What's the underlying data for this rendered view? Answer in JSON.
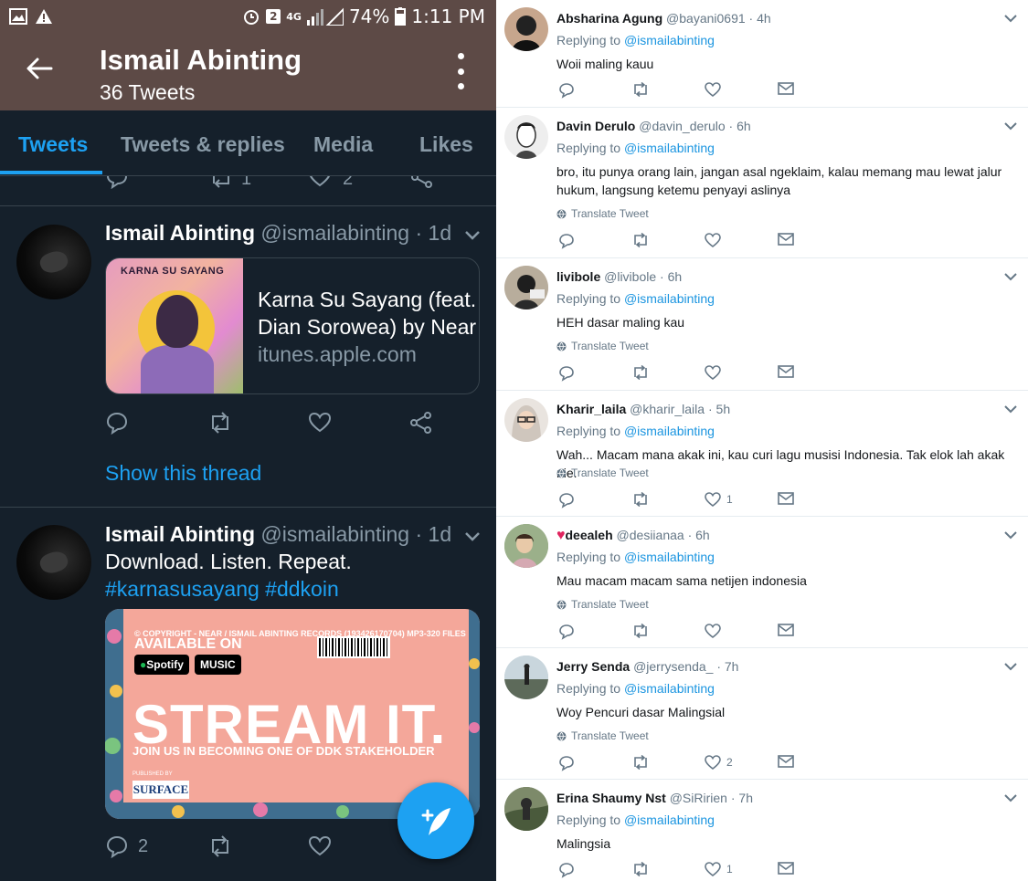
{
  "status_bar": {
    "notif_count": "2",
    "network": "4G",
    "battery": "74%",
    "time": "1:11 PM"
  },
  "profile": {
    "name": "Ismail Abinting",
    "tweet_count": "36 Tweets"
  },
  "tabs": [
    {
      "label": "Tweets",
      "active": true
    },
    {
      "label": "Tweets & replies",
      "active": false
    },
    {
      "label": "Media",
      "active": false
    },
    {
      "label": "Likes",
      "active": false
    }
  ],
  "partial_tweet_actions": {
    "retweets": "1",
    "likes": "2"
  },
  "mobile_tweets": [
    {
      "name": "Ismail Abinting",
      "handle": "@ismailabinting",
      "time": "1d",
      "card": {
        "image_title": "KARNA SU SAYANG",
        "title": "Karna Su Sayang (feat. Dian Sorowea) by Near",
        "domain": "itunes.apple.com"
      },
      "show_thread": "Show this thread"
    },
    {
      "name": "Ismail Abinting",
      "handle": "@ismailabinting",
      "time": "1d",
      "text": "Download. Listen. Repeat.",
      "hashtags": "#karnasusayang #ddkoin",
      "banner": {
        "copyright": "© COPYRIGHT - NEAR / ISMAIL ABINTING RECORDS (193426170704) MP3-320 FILES",
        "available": "AVAILABLE ON",
        "spotify": "Spotify",
        "music": "MUSIC",
        "stream": "STREAM IT.",
        "join": "JOIN US IN BECOMING ONE OF DDK STAKEHOLDER",
        "published": "PUBLISHED BY",
        "publisher": "SURFACE"
      },
      "replies": "2"
    }
  ],
  "replies": [
    {
      "name": "Absharina Agung",
      "handle": "@bayani0691",
      "time": "4h",
      "replying": "Replying to",
      "mention": "@ismailabinting",
      "text": "Woii maling kauu",
      "translate": "",
      "likes": ""
    },
    {
      "name": "Davin Derulo",
      "handle": "@davin_derulo",
      "time": "6h",
      "replying": "Replying to",
      "mention": "@ismailabinting",
      "text": "bro, itu punya orang lain, jangan asal ngeklaim, kalau memang mau lewat jalur hukum, langsung ketemu penyayi aslinya",
      "translate": "Translate Tweet",
      "likes": ""
    },
    {
      "name": "livibole",
      "handle": "@livibole",
      "time": "6h",
      "replying": "Replying to",
      "mention": "@ismailabinting",
      "text": "HEH dasar maling kau",
      "translate": "Translate Tweet",
      "likes": ""
    },
    {
      "name": "Kharir_laila",
      "handle": "@kharir_laila",
      "time": "5h",
      "replying": "Replying to",
      "mention": "@ismailabinting",
      "text": "Wah... Macam mana akak ini, kau curi lagu musisi Indonesia. Tak elok lah akak nie.",
      "translate": "Translate Tweet",
      "likes": "1"
    },
    {
      "name": "deealeh",
      "handle": "@desiianaa",
      "time": "6h",
      "replying": "Replying to",
      "mention": "@ismailabinting",
      "text": "Mau macam macam sama netijen indonesia",
      "translate": "Translate Tweet",
      "likes": ""
    },
    {
      "name": "Jerry Senda",
      "handle": "@jerrysenda_",
      "time": "7h",
      "replying": "Replying to",
      "mention": "@ismailabinting",
      "text": "Woy Pencuri dasar Malingsial",
      "translate": "Translate Tweet",
      "likes": "2"
    },
    {
      "name": "Erina Shaumy Nst",
      "handle": "@SiRirien",
      "time": "7h",
      "replying": "Replying to",
      "mention": "@ismailabinting",
      "text": "Malingsia",
      "translate": "",
      "likes": "1"
    }
  ],
  "colors": {
    "status_brown": "#5d4a46",
    "dark_bg": "#15202b",
    "accent": "#1da1f2",
    "muted": "#8899a6",
    "mention": "#1b95e0"
  }
}
